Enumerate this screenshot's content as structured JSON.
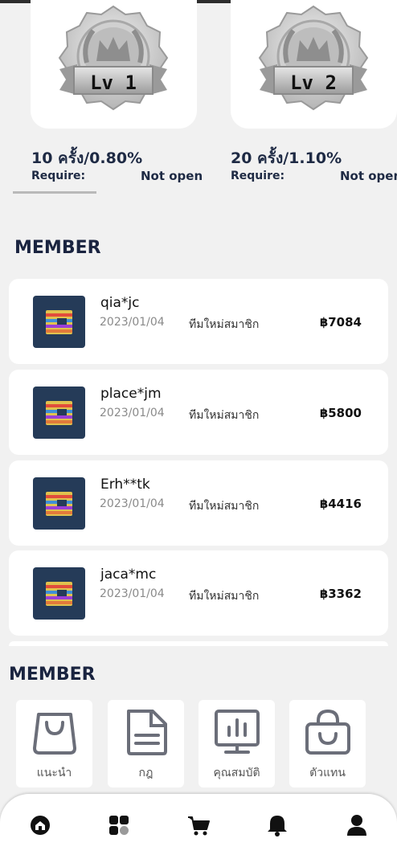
{
  "levels": [
    {
      "badge_label": "Lv 1",
      "title": "10 ครั้ง/0.80%",
      "require_label": "Require:",
      "status": "Not open"
    },
    {
      "badge_label": "Lv 2",
      "title": "20 ครั้ง/1.10%",
      "require_label": "Require:",
      "status": "Not open"
    }
  ],
  "member_section": {
    "title": "MEMBER"
  },
  "members": [
    {
      "name": "qia*jc",
      "date": "2023/01/04",
      "desc": "ทีมใหม่สมาชิก",
      "amount": "฿7084"
    },
    {
      "name": "place*jm",
      "date": "2023/01/04",
      "desc": "ทีมใหม่สมาชิก",
      "amount": "฿5800"
    },
    {
      "name": "Erh**tk",
      "date": "2023/01/04",
      "desc": "ทีมใหม่สมาชิก",
      "amount": "฿4416"
    },
    {
      "name": "jaca*mc",
      "date": "2023/01/04",
      "desc": "ทีมใหม่สมาชิก",
      "amount": "฿3362"
    }
  ],
  "quick_section": {
    "title": "MEMBER"
  },
  "quick_links": [
    {
      "label": "แนะนำ",
      "icon": "shopping-bag-icon"
    },
    {
      "label": "กฎ",
      "icon": "document-icon"
    },
    {
      "label": "คุณสมบัติ",
      "icon": "monitor-chart-icon"
    },
    {
      "label": "ตัวแทน",
      "icon": "bag-smile-icon"
    }
  ],
  "bottom_nav": [
    {
      "icon": "home-icon"
    },
    {
      "icon": "apps-grid-icon"
    },
    {
      "icon": "cart-icon"
    },
    {
      "icon": "bell-icon"
    },
    {
      "icon": "user-icon"
    }
  ],
  "colors": {
    "accent": "#1e2a44",
    "background": "#f1f1f1",
    "icon_gray": "#6b6e79"
  }
}
